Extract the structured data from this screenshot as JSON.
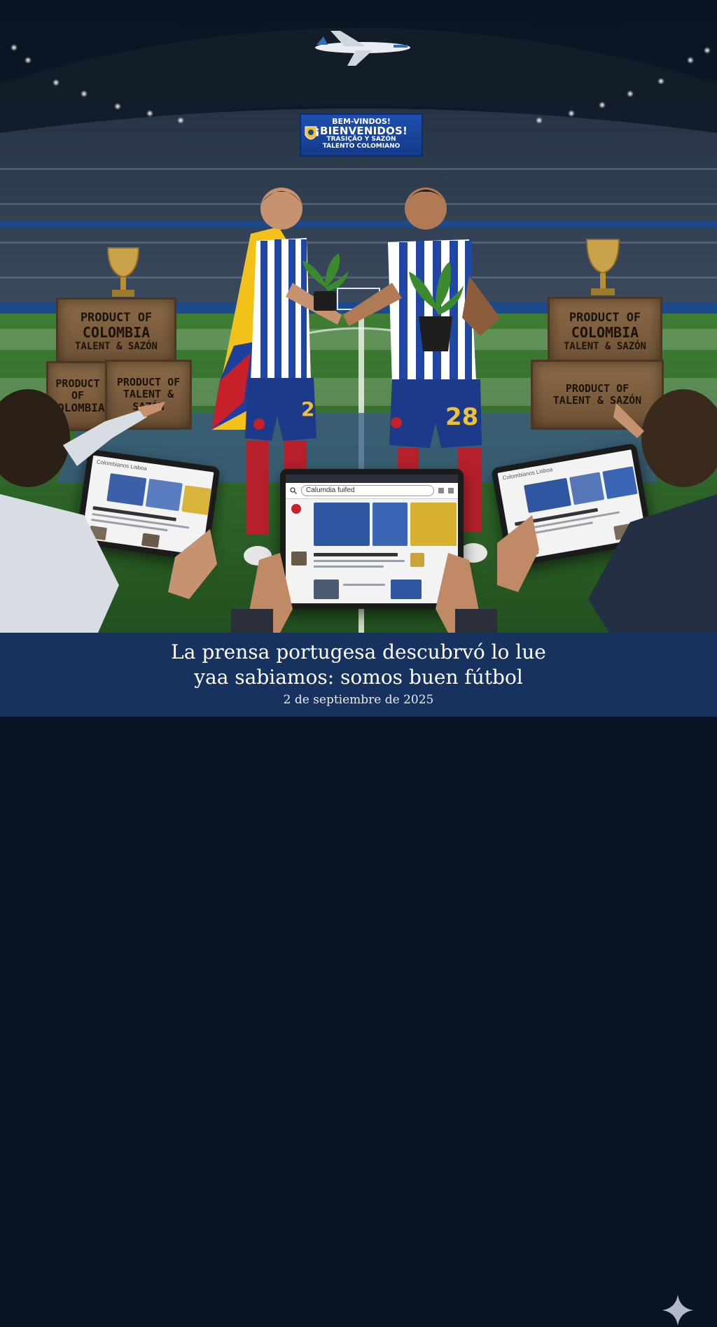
{
  "scoreboard": {
    "line1": "BEM-VINDOS!",
    "line2": "¡BIENVENIDOS!",
    "line3": "TRASIÇÃO Y SAZÓN",
    "line4": "TALENTO COLOMIANO"
  },
  "crates": {
    "left_top": [
      "PRODUCT OF",
      "COLOMBIA",
      "TALENT & SAZÓN"
    ],
    "left_bottom": [
      "PRODUCT OF",
      "COLOMBIA",
      "TALENT & SAZÓN"
    ],
    "right_top": [
      "PRODUCT OF",
      "COLOMBIA",
      "TALENT & SAZÓN"
    ],
    "right_bottom": [
      "PRODUCT OF",
      "TALENT & SAZÓN"
    ]
  },
  "players": {
    "left_number": "2",
    "right_number": "28"
  },
  "tablets": {
    "left_site_title": "Colombianos Lisboa",
    "center_search": "Calumdia fuifed",
    "right_site_title": "Colombianos Lisboa"
  },
  "caption": {
    "title_line1": "La prensa portugesa descubrvó lo lue",
    "title_line2": "yaa sabiamos: somos buen fútbol",
    "date": "2 de septiembre de 2025"
  },
  "colors": {
    "caption_bg": "#17325e",
    "pitch": "#2f6a2c",
    "kit_blue": "#1d3a8a",
    "kit_stripe": "#ffffff",
    "flag_yellow": "#f2c21a",
    "flag_blue": "#1f3f9e",
    "flag_red": "#c8202b"
  }
}
